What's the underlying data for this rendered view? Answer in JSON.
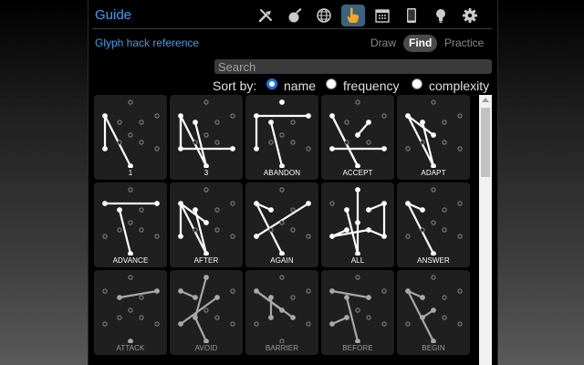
{
  "title": "Guide",
  "toolbar": [
    {
      "icon": "tools-icon",
      "active": false
    },
    {
      "icon": "bomb-icon",
      "active": false
    },
    {
      "icon": "globe-icon",
      "active": false
    },
    {
      "icon": "hand-pointer-icon",
      "active": true
    },
    {
      "icon": "calendar-icon",
      "active": false
    },
    {
      "icon": "tablet-icon",
      "active": false
    },
    {
      "icon": "lightbulb-icon",
      "active": false
    },
    {
      "icon": "gear-icon",
      "active": false
    }
  ],
  "subtitle": "Glyph hack reference",
  "modes": {
    "draw": "Draw",
    "find": "Find",
    "practice": "Practice",
    "active": "Find"
  },
  "search": {
    "placeholder": "Search",
    "value": ""
  },
  "sort": {
    "label": "Sort by:",
    "options": [
      "name",
      "frequency",
      "complexity"
    ],
    "selected": "name"
  },
  "glyphs": [
    {
      "name": "1",
      "faded": false,
      "path": [
        [
          6,
          4
        ],
        [
          6,
          5
        ]
      ]
    },
    {
      "name": "3",
      "faded": false,
      "path": [
        [
          6,
          4
        ],
        [
          5,
          3
        ],
        [
          10,
          4
        ],
        [
          6,
          5
        ],
        [
          5,
          6
        ]
      ]
    },
    {
      "name": "ABANDON",
      "faded": false,
      "path": [
        [
          2,
          6
        ],
        [
          5,
          6
        ],
        [
          10,
          4
        ],
        [
          1,
          1
        ]
      ]
    },
    {
      "name": "ACCEPT",
      "faded": false,
      "path": [
        [
          6,
          4
        ],
        [
          0,
          7
        ],
        [
          5,
          3
        ],
        [
          6,
          4
        ]
      ]
    },
    {
      "name": "ADAPT",
      "faded": false,
      "path": [
        [
          10,
          4
        ],
        [
          6,
          4
        ],
        [
          0,
          6
        ]
      ]
    },
    {
      "name": "ADVANCE",
      "faded": false,
      "path": [
        [
          2,
          6
        ],
        [
          10,
          4
        ]
      ]
    },
    {
      "name": "AFTER",
      "faded": false,
      "path": [
        [
          6,
          4
        ],
        [
          10,
          4
        ],
        [
          6,
          5
        ],
        [
          0,
          6
        ]
      ]
    },
    {
      "name": "AGAIN",
      "faded": false,
      "path": [
        [
          2,
          5
        ],
        [
          10,
          6
        ],
        [
          4,
          6
        ]
      ]
    },
    {
      "name": "ALL",
      "faded": false,
      "path": [
        [
          0,
          1
        ],
        [
          7,
          2
        ],
        [
          8,
          3
        ],
        [
          0,
          4
        ],
        [
          5,
          9
        ],
        [
          3,
          2
        ],
        [
          8,
          5
        ],
        [
          4,
          10
        ]
      ]
    },
    {
      "name": "ANSWER",
      "faded": false,
      "path": [
        [
          6,
          10
        ],
        [
          4,
          6
        ]
      ]
    },
    {
      "name": "ATTACK",
      "faded": true,
      "path": [
        [
          2,
          10
        ],
        [
          4,
          4
        ]
      ]
    },
    {
      "name": "AVOID",
      "faded": true,
      "path": [
        [
          7,
          5
        ],
        [
          4,
          9
        ],
        [
          10,
          6
        ],
        [
          9,
          1
        ]
      ]
    },
    {
      "name": "BARRIER",
      "faded": true,
      "path": [
        [
          0,
          6
        ],
        [
          6,
          8
        ],
        [
          9,
          10
        ]
      ]
    },
    {
      "name": "BEFORE",
      "faded": true,
      "path": [
        [
          7,
          6
        ],
        [
          5,
          9
        ],
        [
          10,
          4
        ]
      ]
    },
    {
      "name": "BEGIN",
      "faded": true,
      "path": [
        [
          0,
          9
        ],
        [
          6,
          4
        ],
        [
          10,
          6
        ]
      ]
    }
  ],
  "colors": {
    "accent": "#3aa0f0",
    "active_tab": "#39647f",
    "radio_checked": "#1a73e8"
  }
}
